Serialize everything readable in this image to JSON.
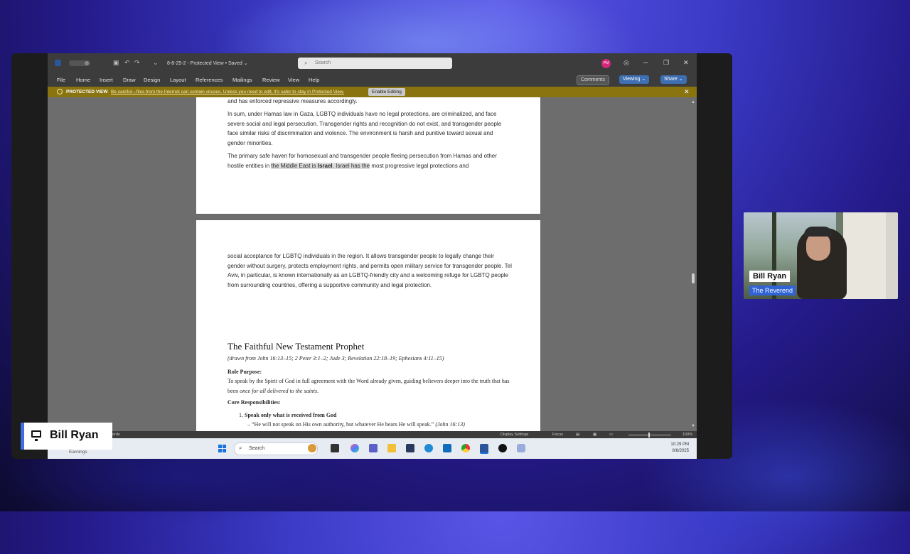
{
  "word": {
    "title_bar": {
      "doc_name": "8-8-25-2 - Protected View • Saved ⌄",
      "search_placeholder": "Search",
      "avatar_initials": "PM"
    },
    "menu": [
      "File",
      "Home",
      "Insert",
      "Draw",
      "Design",
      "Layout",
      "References",
      "Mailings",
      "Review",
      "View",
      "Help"
    ],
    "ribbon_buttons": {
      "comments": "Comments",
      "viewing": "Viewing ⌄",
      "share": "Share ⌄"
    },
    "protected_view": {
      "label": "PROTECTED VIEW",
      "message": "Be careful—files from the Internet can contain viruses. Unless you need to edit, it's safer to stay in Protected View.",
      "enable_button": "Enable Editing"
    },
    "page1": {
      "line0": "and has enforced repressive measures accordingly.",
      "para1": "In sum, under Hamas law in Gaza, LGBTQ individuals have no legal protections, are criminalized, and face severe social and legal persecution. Transgender rights and recognition do not exist, and transgender people face similar risks of discrimination and violence. The environment is harsh and punitive toward sexual and gender minorities.",
      "para2_start": "The primary safe haven for homosexual and transgender people fleeing persecution from Hamas and other hostile entities in ",
      "para2_hl": "the Middle East is ",
      "para2_bold": "Israel",
      "para2_hl2": ". Israel has the",
      "para2_end": " most progressive legal protections and"
    },
    "page2": {
      "para1": "social acceptance for LGBTQ individuals in the region. It allows transgender people to legally change their gender without surgery, protects employment rights, and permits open military service for transgender people. Tel Aviv, in particular, is known internationally as an LGBTQ-friendly city and a welcoming refuge for LGBTQ people from surrounding countries, offering a supportive community and legal protection.",
      "heading": "The Faithful New Testament Prophet",
      "subtitle": "(drawn from John 16:13–15; 2 Peter 3:1–2; Jude 3; Revelation 22:18–19; Ephesians 4:11–15)",
      "role_label": "Role Purpose:",
      "role_text_a": "To speak by the Spirit of God in full agreement with the Word already given, guiding believers deeper into the truth that has been ",
      "role_text_em": "once for all delivered to the saints",
      "role_text_b": ".",
      "core_label": "Core Responsibilities:",
      "item1_num": "1.",
      "item1_title": "Speak only what is received from God",
      "item1_quote": "– “He will not speak on His own authority, but whatever He hears He will speak.”",
      "item1_ref": "(John 16:13)"
    },
    "status_bar": {
      "words": "Words",
      "display_settings": "Display Settings",
      "focus": "Focus",
      "zoom": "100%"
    }
  },
  "taskbar": {
    "widget": "Earnings",
    "search_placeholder": "Search",
    "time": "10:29 PM",
    "date": "8/8/2025"
  },
  "camera": {
    "name": "Bill Ryan",
    "role": "The Reverend"
  },
  "presenter": {
    "name": "Bill Ryan"
  }
}
